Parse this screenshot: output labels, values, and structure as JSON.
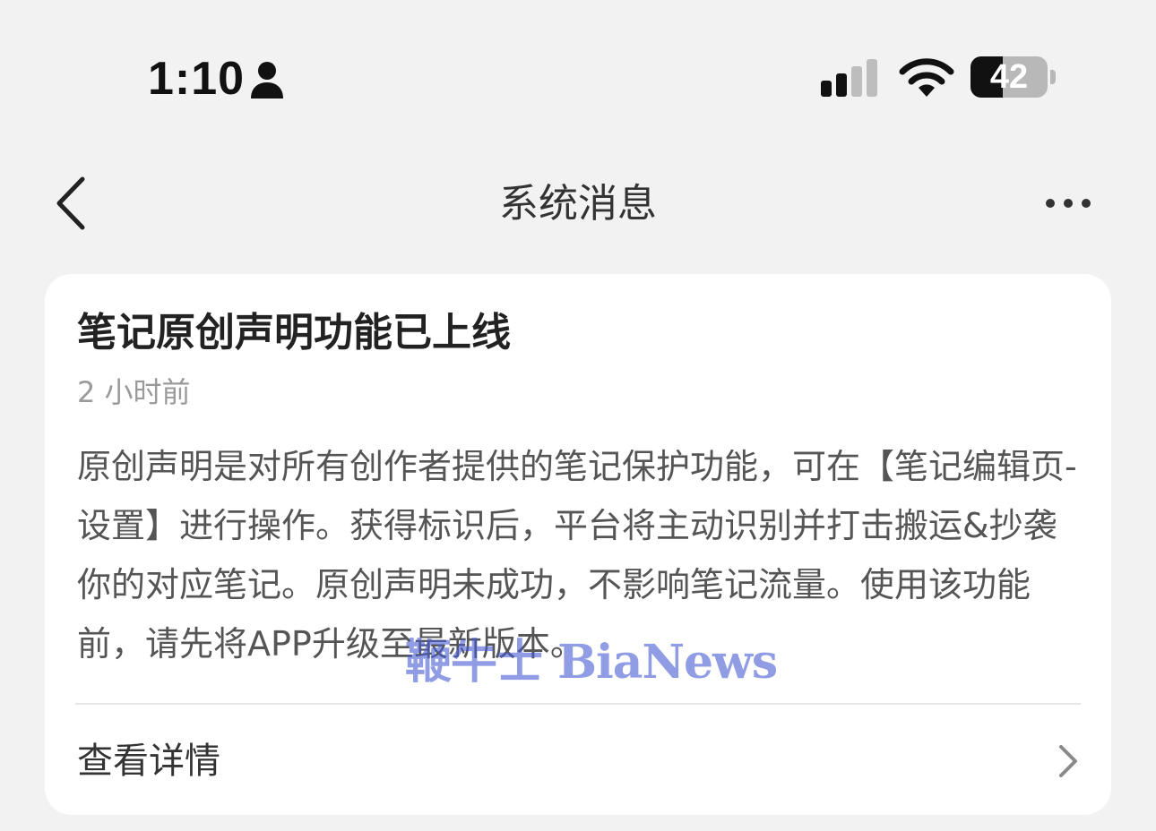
{
  "status_bar": {
    "time": "1:10",
    "battery_level": "42",
    "battery_fraction": 0.42,
    "icons": [
      "person-icon",
      "signal-icon",
      "wifi-icon",
      "battery-icon"
    ]
  },
  "nav": {
    "title": "系统消息",
    "back_icon": "chevron-left-icon",
    "more_icon": "more-icon"
  },
  "message": {
    "title": "笔记原创声明功能已上线",
    "time": "2 小时前",
    "body": "原创声明是对所有创作者提供的笔记保护功能，可在【笔记编辑页-设置】进行操作。获得标识后，平台将主动识别并打击搬运&抄袭你的对应笔记。原创声明未成功，不影响笔记流量。使用该功能前，请先将APP升级至最新版本。",
    "detail_label": "查看详情"
  },
  "watermark": "鞭牛士 BiaNews",
  "colors": {
    "background": "#f2f2f2",
    "card": "#ffffff",
    "watermark": "#465ad2"
  }
}
